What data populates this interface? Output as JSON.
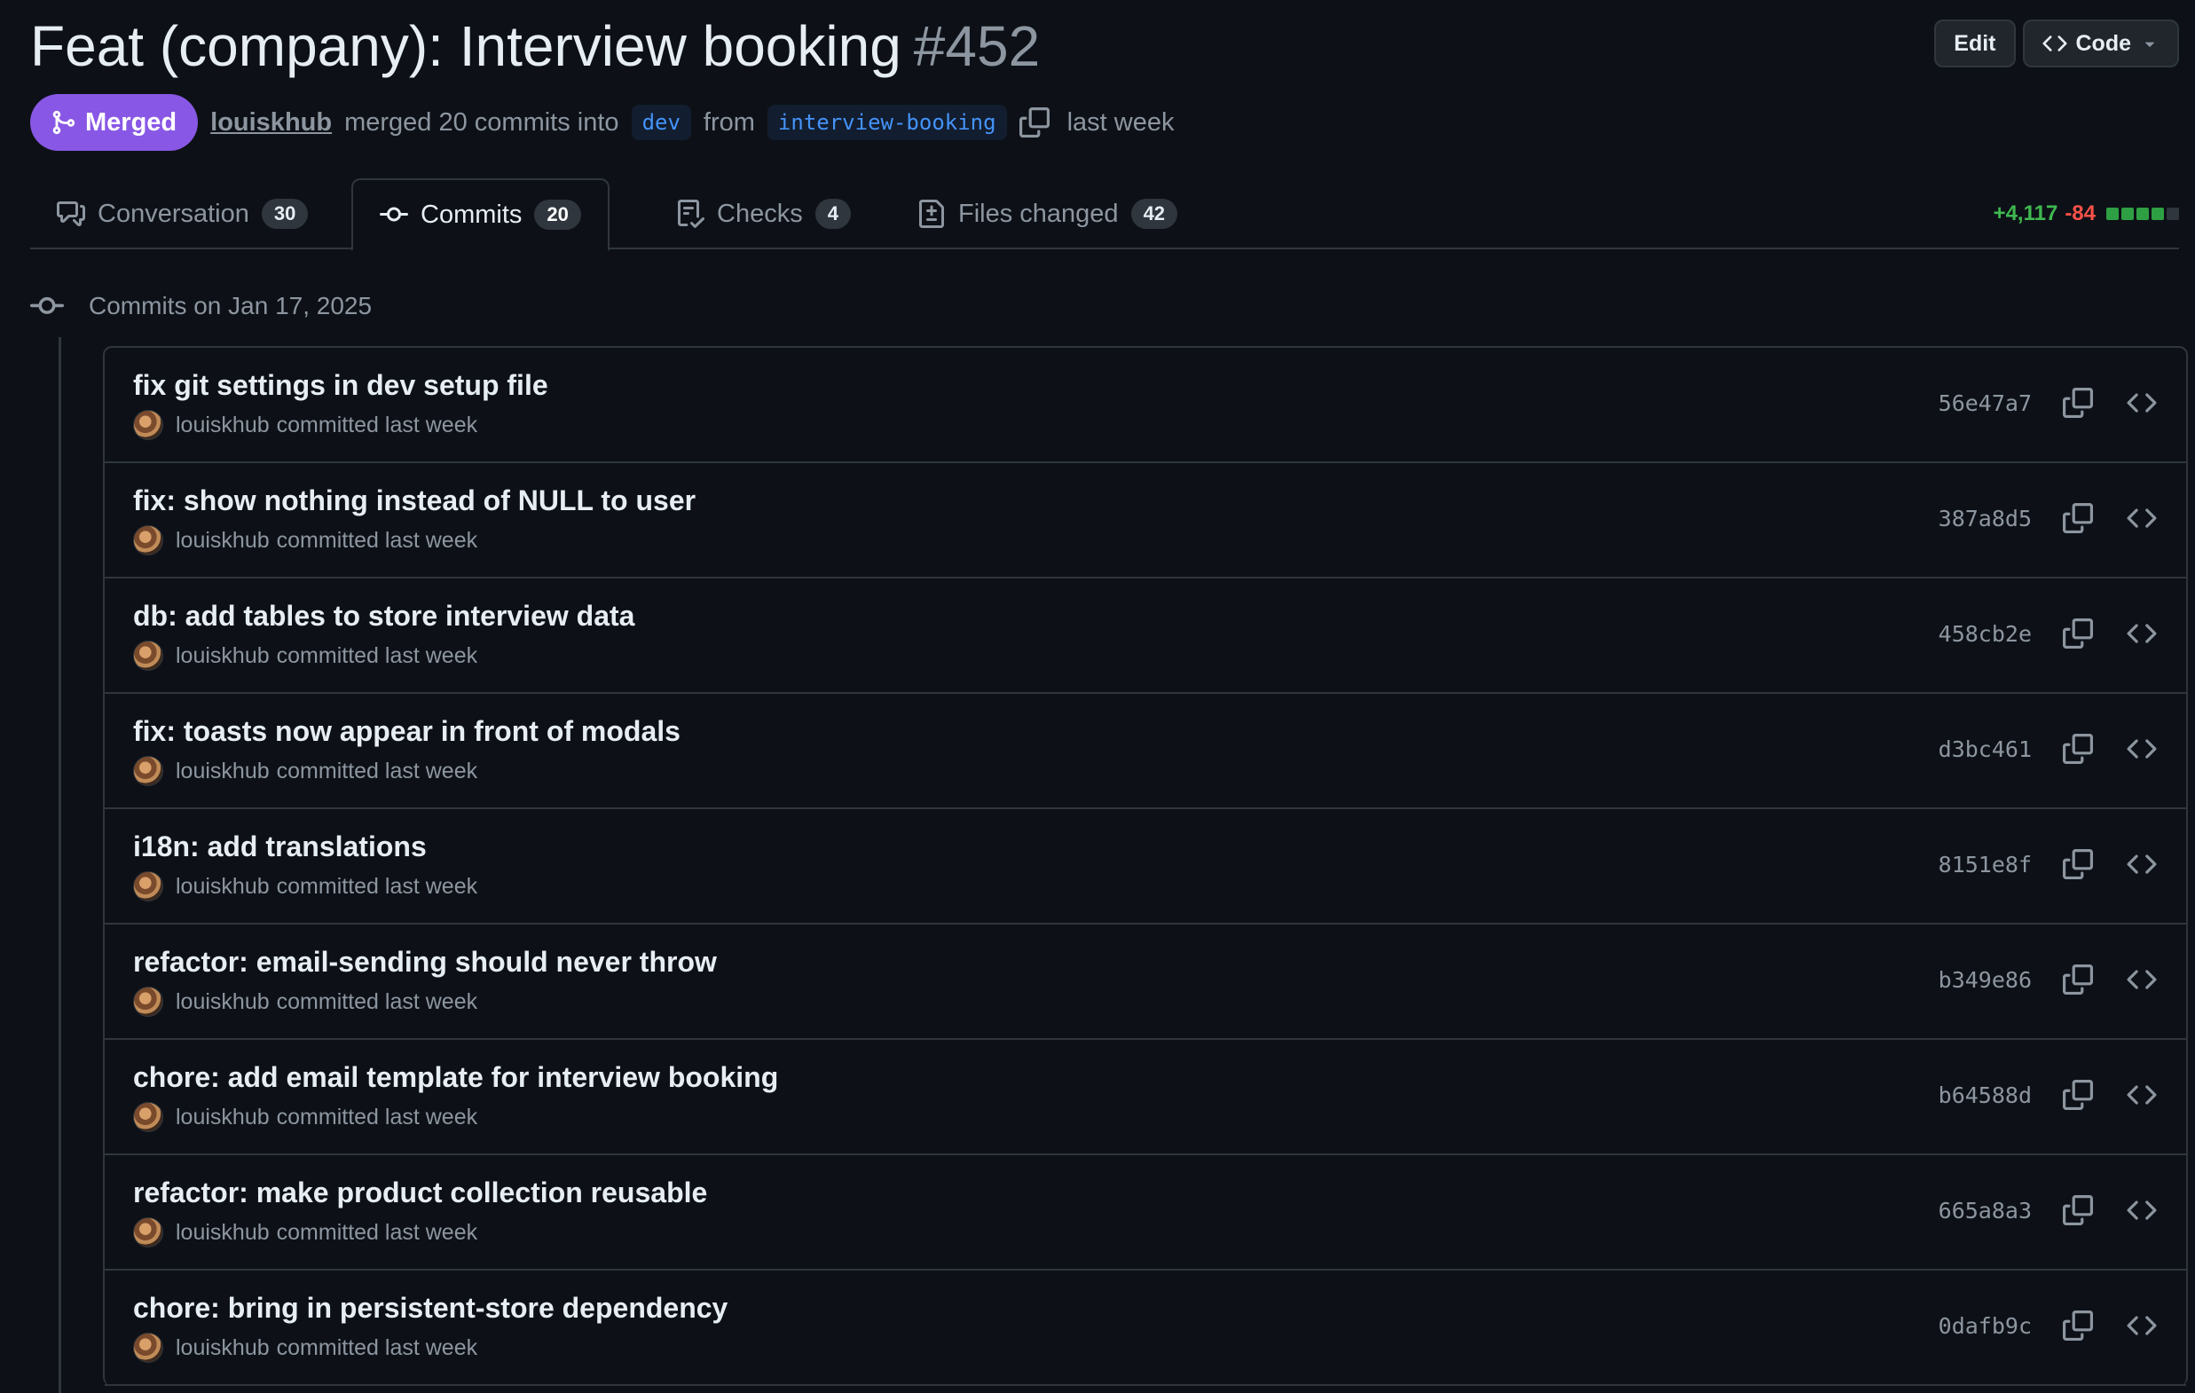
{
  "header": {
    "title": "Feat (company): Interview booking",
    "number": "#452",
    "edit_label": "Edit",
    "code_label": "Code"
  },
  "meta": {
    "state": "Merged",
    "author": "louiskhub",
    "merged_text": "merged 20 commits into",
    "base_branch": "dev",
    "from_text": "from",
    "head_branch": "interview-booking",
    "time": "last week"
  },
  "tabs": [
    {
      "label": "Conversation",
      "count": "30",
      "icon": "comment-discussion-icon"
    },
    {
      "label": "Commits",
      "count": "20",
      "icon": "git-commit-icon"
    },
    {
      "label": "Checks",
      "count": "4",
      "icon": "checklist-icon"
    },
    {
      "label": "Files changed",
      "count": "42",
      "icon": "file-diff-icon"
    }
  ],
  "diffstat": {
    "additions": "+4,117",
    "deletions": "-84",
    "colors": {
      "add": "#3fb950",
      "del": "#f85149",
      "neutral": "#30363d"
    }
  },
  "timeline": {
    "heading": "Commits on Jan 17, 2025"
  },
  "commits": [
    {
      "title": "fix git settings in dev setup file",
      "author": "louiskhub",
      "meta": "committed last week",
      "sha": "56e47a7"
    },
    {
      "title": "fix: show nothing instead of NULL to user",
      "author": "louiskhub",
      "meta": "committed last week",
      "sha": "387a8d5"
    },
    {
      "title": "db: add tables to store interview data",
      "author": "louiskhub",
      "meta": "committed last week",
      "sha": "458cb2e"
    },
    {
      "title": "fix: toasts now appear in front of modals",
      "author": "louiskhub",
      "meta": "committed last week",
      "sha": "d3bc461"
    },
    {
      "title": "i18n: add translations",
      "author": "louiskhub",
      "meta": "committed last week",
      "sha": "8151e8f"
    },
    {
      "title": "refactor: email-sending should never throw",
      "author": "louiskhub",
      "meta": "committed last week",
      "sha": "b349e86"
    },
    {
      "title": "chore: add email template for interview booking",
      "author": "louiskhub",
      "meta": "committed last week",
      "sha": "b64588d"
    },
    {
      "title": "refactor: make product collection reusable",
      "author": "louiskhub",
      "meta": "committed last week",
      "sha": "665a8a3"
    },
    {
      "title": "chore: bring in persistent-store dependency",
      "author": "louiskhub",
      "meta": "committed last week",
      "sha": "0dafb9c"
    }
  ],
  "theme": {
    "background": "#0d1117",
    "border": "#30363d",
    "merged": "#8957e5",
    "link": "#4493f8"
  }
}
